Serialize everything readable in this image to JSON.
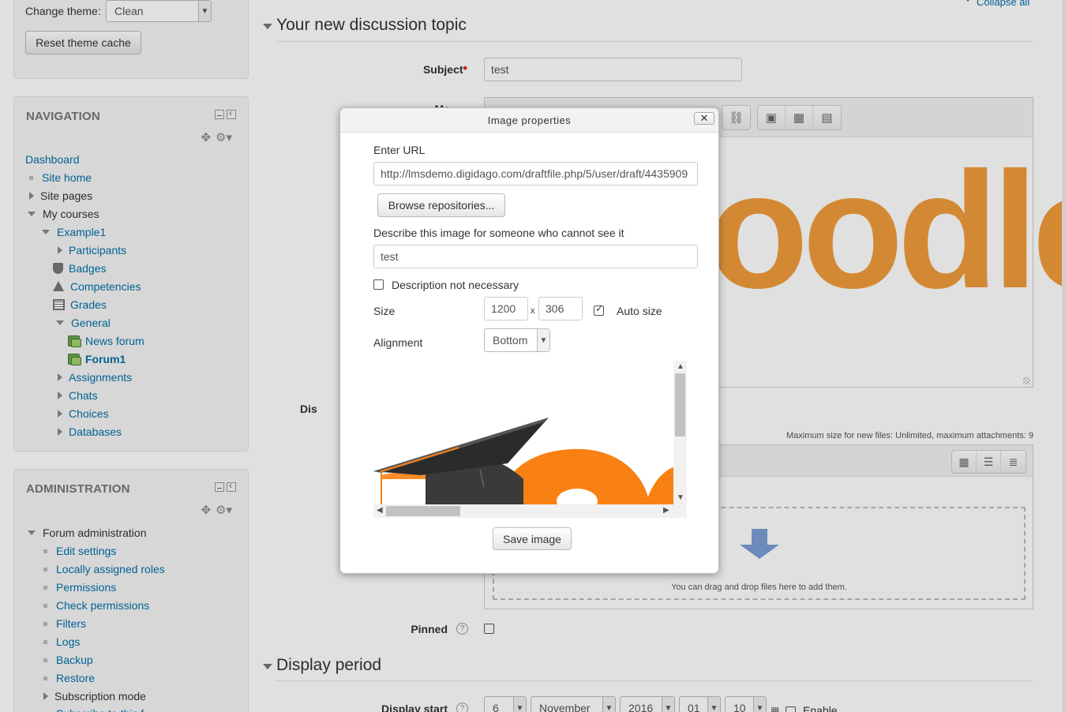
{
  "theme": {
    "label": "Change theme:",
    "value": "Clean",
    "reset_label": "Reset theme cache"
  },
  "navigation": {
    "title": "NAVIGATION",
    "items": {
      "dashboard": "Dashboard",
      "site_home": "Site home",
      "site_pages": "Site pages",
      "my_courses": "My courses",
      "example1": "Example1",
      "participants": "Participants",
      "badges": "Badges",
      "competencies": "Competencies",
      "grades": "Grades",
      "general": "General",
      "news_forum": "News forum",
      "forum1": "Forum1",
      "assignments": "Assignments",
      "chats": "Chats",
      "choices": "Choices",
      "databases": "Databases"
    }
  },
  "administration": {
    "title": "ADMINISTRATION",
    "items": {
      "forum_admin": "Forum administration",
      "edit_settings": "Edit settings",
      "local_roles": "Locally assigned roles",
      "permissions": "Permissions",
      "check_permissions": "Check permissions",
      "filters": "Filters",
      "logs": "Logs",
      "backup": "Backup",
      "restore": "Restore",
      "subscription_mode": "Subscription mode",
      "subscribe_partial": "Subscribe to this f..."
    }
  },
  "form": {
    "collapse_all": "Collapse all",
    "section_title": "Your new discussion topic",
    "subject_label": "Subject",
    "subject_required": "*",
    "subject_value": "test",
    "message_label_partial": "Me",
    "editor_logo_text": "oodle",
    "attachment_label_partial": "Dis",
    "max_size_text": "Maximum size for new files: Unlimited, maximum attachments: 9",
    "drop_text": "You can drag and drop files here to add them.",
    "pinned_label": "Pinned",
    "display_period_title": "Display period",
    "display_start_label": "Display start",
    "date": {
      "day": "6",
      "month": "November",
      "year": "2016",
      "hour": "01",
      "minute": "10",
      "enable_label": "Enable"
    }
  },
  "dialog": {
    "title": "Image properties",
    "close": "✕",
    "url_label": "Enter URL",
    "url_value": "http://lmsdemo.digidago.com/draftfile.php/5/user/draft/4435909",
    "browse_label": "Browse repositories...",
    "describe_label": "Describe this image for someone who cannot see it",
    "describe_value": "test",
    "not_necessary_label": "Description not necessary",
    "size_label": "Size",
    "width": "1200",
    "size_separator": "x",
    "height": "306",
    "autosize_label": "Auto size",
    "alignment_label": "Alignment",
    "alignment_value": "Bottom",
    "save_label": "Save image"
  },
  "colors": {
    "link": "#0070a8",
    "moodle_orange": "#f98012",
    "logo_light": "#f19d3c"
  }
}
